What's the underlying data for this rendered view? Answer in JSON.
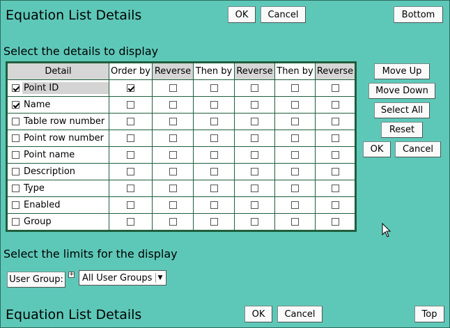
{
  "header": {
    "title": "Equation List Details",
    "ok_label": "OK",
    "cancel_label": "Cancel",
    "bottom_label": "Bottom"
  },
  "details_section": {
    "heading": "Select the details to display",
    "columns": [
      "Detail",
      "Order by",
      "Reverse",
      "Then by",
      "Reverse",
      "Then by",
      "Reverse"
    ],
    "rows": [
      {
        "label": "Point ID",
        "checked": true,
        "order_by": true
      },
      {
        "label": "Name",
        "checked": true,
        "order_by": false
      },
      {
        "label": "Table row number",
        "checked": false,
        "order_by": false
      },
      {
        "label": "Point row number",
        "checked": false,
        "order_by": false
      },
      {
        "label": "Point name",
        "checked": false,
        "order_by": false
      },
      {
        "label": "Description",
        "checked": false,
        "order_by": false
      },
      {
        "label": "Type",
        "checked": false,
        "order_by": false
      },
      {
        "label": "Enabled",
        "checked": false,
        "order_by": false
      },
      {
        "label": "Group",
        "checked": false,
        "order_by": false
      }
    ]
  },
  "side_buttons": {
    "move_up": "Move Up",
    "move_down": "Move Down",
    "select_all": "Select All",
    "reset": "Reset",
    "ok": "OK",
    "cancel": "Cancel"
  },
  "limits_section": {
    "heading": "Select the limits for the display",
    "user_group_label": "User Group:",
    "user_group_value": "All User Groups"
  },
  "footer": {
    "title": "Equation List Details",
    "ok_label": "OK",
    "cancel_label": "Cancel",
    "top_label": "Top"
  },
  "colors": {
    "background": "#5ec8b8",
    "table_border": "#1f5e3c"
  }
}
